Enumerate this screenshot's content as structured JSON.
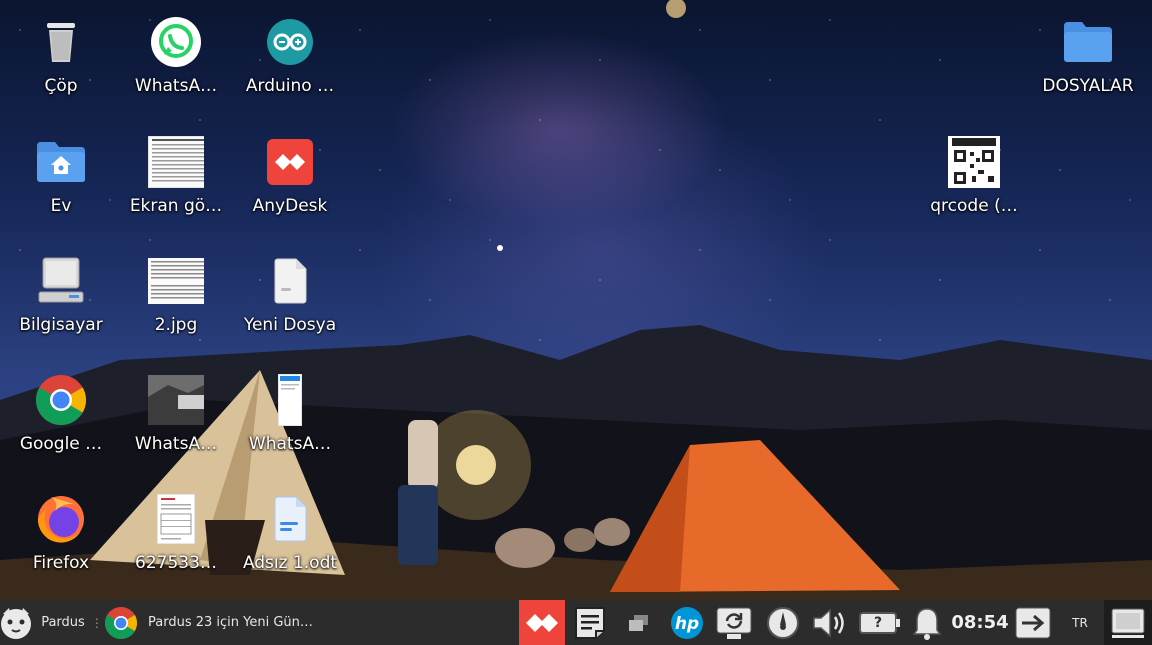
{
  "desktop": {
    "icons": [
      {
        "label": "Çöp",
        "icon": "trash-icon"
      },
      {
        "label": "WhatsA…",
        "icon": "whatsapp-icon"
      },
      {
        "label": "Arduino …",
        "icon": "arduino-icon"
      },
      {
        "label": "DOSYALAR",
        "icon": "folder-icon"
      },
      {
        "label": "Ev",
        "icon": "home-folder-icon"
      },
      {
        "label": "Ekran gö…",
        "icon": "screenshot-document-thumbnail"
      },
      {
        "label": "AnyDesk",
        "icon": "anydesk-icon"
      },
      {
        "label": "qrcode (…",
        "icon": "qrcode-thumbnail"
      },
      {
        "label": "Bilgisayar",
        "icon": "computer-icon"
      },
      {
        "label": "2.jpg",
        "icon": "image-thumbnail"
      },
      {
        "label": "Yeni Dosya",
        "icon": "blank-file-icon"
      },
      {
        "label": "Google …",
        "icon": "chrome-icon"
      },
      {
        "label": "WhatsA…",
        "icon": "photo-thumbnail"
      },
      {
        "label": "WhatsA…",
        "icon": "phone-screenshot-thumbnail"
      },
      {
        "label": "Firefox",
        "icon": "firefox-icon"
      },
      {
        "label": "627533…",
        "icon": "document-thumbnail"
      },
      {
        "label": "Adsız 1.odt",
        "icon": "writer-document-icon"
      }
    ]
  },
  "taskbar": {
    "start_label": "Pardus",
    "window_title": "Pardus 23 için Yeni Gün…",
    "clock": "08:54",
    "keyboard_layout": "TR",
    "battery_status": "?",
    "colors": {
      "anydesk": "#ef443b",
      "background": "#2c2c2c"
    }
  }
}
